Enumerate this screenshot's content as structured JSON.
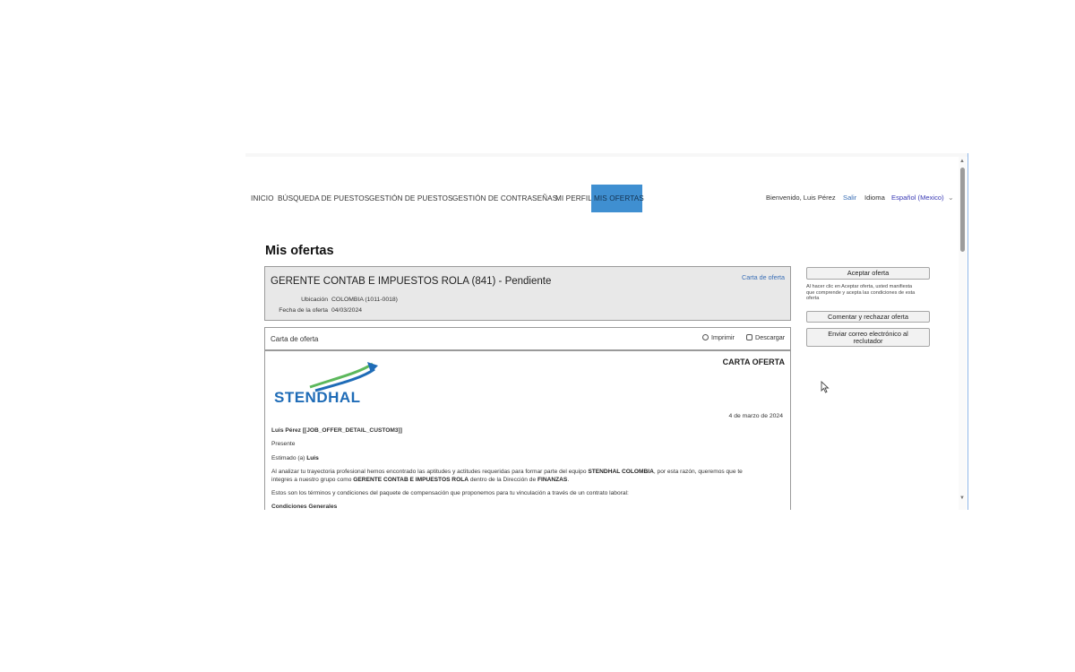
{
  "nav": {
    "items": [
      {
        "label": "INICIO"
      },
      {
        "label": "BÚSQUEDA DE PUESTOS"
      },
      {
        "label": "GESTIÓN DE PUESTOS"
      },
      {
        "label": "GESTIÓN DE CONTRASEÑAS"
      },
      {
        "label": "MI PERFIL"
      },
      {
        "label": "MIS OFERTAS"
      }
    ],
    "active_color": "#3f8fd1"
  },
  "user": {
    "welcome": "Bienvenido, Luis Pérez",
    "logout": "Salir",
    "language_label": "Idioma",
    "language_value": "Español (Mexico)"
  },
  "page": {
    "title": "Mis ofertas"
  },
  "offer": {
    "title": "GERENTE CONTAB E IMPUESTOS ROLA (841) - Pendiente",
    "link": "Carta de oferta",
    "location_label": "Ubicación",
    "location_value": "COLOMBIA (1011-0018)",
    "date_label": "Fecha de la oferta",
    "date_value": "04/03/2024"
  },
  "letter": {
    "header_label": "Carta de oferta",
    "print_label": "Imprimir",
    "download_label": "Descargar",
    "heading": "CARTA OFERTA",
    "logo_text": "STENDHAL",
    "date": "4 de marzo de 2024",
    "recipient": "Luis Pérez [[JOB_OFFER_DETAIL_CUSTOM3]]",
    "presente": "Presente",
    "greeting_prefix": "Estimado (a) ",
    "greeting_name": "Luis",
    "p1_a": "Al analizar tu trayectoria profesional hemos encontrado las aptitudes y actitudes requeridas para formar parte del equipo ",
    "p1_company": "STENDHAL COLOMBIA",
    "p1_b": ", por esta razón, queremos que te",
    "p1_c": "integres a nuestro grupo como ",
    "p1_role": "GERENTE CONTAB E IMPUESTOS ROLA",
    "p1_d": " dentro de la Dirección de ",
    "p1_dept": "FINANZAS",
    "p1_e": ".",
    "p2": "Estos son los términos y condiciones del paquete de compensación que proponemos para tu vinculación a través de un contrato laboral:",
    "section": "Condiciones Generales"
  },
  "actions": {
    "accept": "Aceptar oferta",
    "accept_note": "Al hacer clic en Aceptar oferta, usted manifiesta que comprende y acepta las condiciones de esta oferta",
    "reject": "Comentar y rechazar oferta",
    "email": "Enviar correo electrónico al reclutador"
  },
  "colors": {
    "brand_blue": "#1f6cb7",
    "logo_green": "#5cb85c",
    "link_blue": "#3b6fb6"
  },
  "icons": [
    "print-icon",
    "download-icon",
    "chevron-down-icon",
    "cursor-icon"
  ]
}
